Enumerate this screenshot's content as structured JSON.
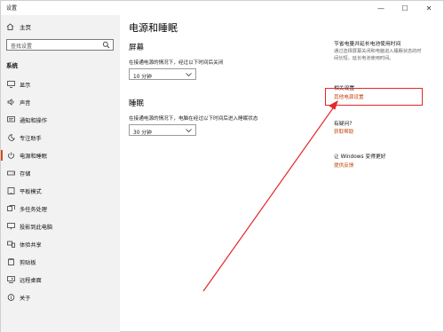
{
  "window": {
    "title": "设置",
    "min_glyph": "—",
    "max_glyph": "☐",
    "close_glyph": "✕"
  },
  "sidebar": {
    "home_label": "主页",
    "search_placeholder": "查找设置",
    "section_label": "系统",
    "items": [
      {
        "label": "显示",
        "icon": "monitor-icon"
      },
      {
        "label": "声音",
        "icon": "speaker-icon"
      },
      {
        "label": "通知和操作",
        "icon": "notification-icon"
      },
      {
        "label": "专注助手",
        "icon": "moon-icon"
      },
      {
        "label": "电源和睡眠",
        "icon": "power-icon",
        "active": true
      },
      {
        "label": "存储",
        "icon": "storage-icon"
      },
      {
        "label": "平板模式",
        "icon": "tablet-icon"
      },
      {
        "label": "多任务处理",
        "icon": "multitask-icon"
      },
      {
        "label": "投影到此电脑",
        "icon": "project-icon"
      },
      {
        "label": "体验共享",
        "icon": "share-icon"
      },
      {
        "label": "剪贴板",
        "icon": "clipboard-icon"
      },
      {
        "label": "远程桌面",
        "icon": "remote-icon"
      },
      {
        "label": "关于",
        "icon": "info-icon"
      }
    ]
  },
  "main": {
    "title": "电源和睡眠",
    "screen": {
      "heading": "屏幕",
      "desc": "在接通电源的情况下，经过以下时间后关闭",
      "value": "10 分钟"
    },
    "sleep": {
      "heading": "睡眠",
      "desc": "在接通电源的情况下，电脑在经过以下时间后进入睡眠状态",
      "value": "30 分钟"
    }
  },
  "right": {
    "tip_title": "节省电量并延长电池使用时间",
    "tip_text": "通过选择屏幕关闭和电脑进入睡眠状态的时间长短，延长电池使用时间。",
    "related_title": "相关设置",
    "related_link": "其他电源设置",
    "help_title": "有疑问?",
    "help_link": "获取帮助",
    "improve_title": "让 Windows 变得更好",
    "improve_link": "提供反馈"
  },
  "annotation": {
    "color": "#e5262b"
  }
}
